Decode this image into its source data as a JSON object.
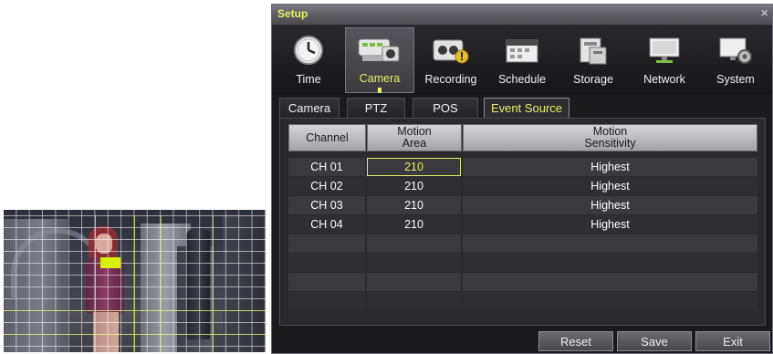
{
  "window": {
    "title": "Setup",
    "close_glyph": "×"
  },
  "categories": [
    {
      "label": "Time",
      "icon": "clock-icon"
    },
    {
      "label": "Camera",
      "icon": "camera-icon"
    },
    {
      "label": "Recording",
      "icon": "recorder-icon"
    },
    {
      "label": "Schedule",
      "icon": "calendar-icon"
    },
    {
      "label": "Storage",
      "icon": "storage-icon"
    },
    {
      "label": "Network",
      "icon": "monitor-icon"
    },
    {
      "label": "System",
      "icon": "system-gear-icon"
    }
  ],
  "active_category": "Camera",
  "subtabs": [
    {
      "label": "Camera"
    },
    {
      "label": "PTZ"
    },
    {
      "label": "POS"
    },
    {
      "label": "Event Source"
    }
  ],
  "active_subtab": "Event Source",
  "table": {
    "headers": {
      "channel": "Channel",
      "motion_area_1": "Motion",
      "motion_area_2": "Area",
      "sensitivity_1": "Motion",
      "sensitivity_2": "Sensitivity"
    },
    "rows": [
      {
        "channel": "CH 01",
        "area": "210",
        "sensitivity": "Highest"
      },
      {
        "channel": "CH 02",
        "area": "210",
        "sensitivity": "Highest"
      },
      {
        "channel": "CH 03",
        "area": "210",
        "sensitivity": "Highest"
      },
      {
        "channel": "CH 04",
        "area": "210",
        "sensitivity": "Highest"
      }
    ]
  },
  "buttons": {
    "reset": "Reset",
    "save": "Save",
    "exit": "Exit"
  },
  "colors": {
    "accent": "#e8f06a",
    "background": "#1b1b1e",
    "motion_marker": "#d8f000"
  }
}
